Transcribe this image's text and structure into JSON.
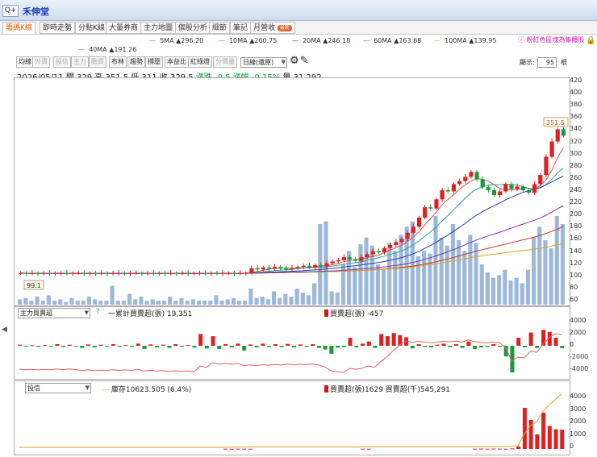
{
  "header": {
    "zoom_label": "Q+",
    "stock_name": "禾伸堂"
  },
  "tabs": [
    {
      "label": "籌碼K線",
      "active": true
    },
    {
      "label": "即時走勢",
      "active": false
    },
    {
      "label": "分點K線",
      "active": false
    },
    {
      "label": "大量券商",
      "active": false
    },
    {
      "label": "主力地圖",
      "active": false
    },
    {
      "label": "個股分析",
      "active": false
    },
    {
      "label": "細節",
      "active": false
    },
    {
      "label": "筆記",
      "active": false
    },
    {
      "label": "月營收",
      "active": false
    }
  ],
  "tab_badge": "最新",
  "hint_text": "ⓘ 粉紅色區塊為集體股",
  "ma_legend": [
    {
      "label": "5MA ▲296.20",
      "color": "#d9534f"
    },
    {
      "label": "10MA ▲260.75",
      "color": "#2aa198"
    },
    {
      "label": "20MA ▲246.18",
      "color": "#1f3fa8"
    },
    {
      "label": "60MA ▲163.68",
      "color": "#c0392b"
    },
    {
      "label": "100MA ▲139.95",
      "color": "#e0a020"
    },
    {
      "label": "40MA ▲191.26",
      "color": "#7a3aa0"
    }
  ],
  "toolbar": {
    "buttons": [
      {
        "label": "均線",
        "dim": false
      },
      {
        "label": "外資",
        "dim": true
      },
      {
        "label": "投信",
        "dim": true
      },
      {
        "label": "主力",
        "dim": true
      },
      {
        "label": "融資",
        "dim": true
      },
      {
        "label": "布林",
        "dim": false
      },
      {
        "label": "趨勢",
        "dim": false
      },
      {
        "label": "撐壓",
        "dim": false
      },
      {
        "label": "本益比",
        "dim": false
      },
      {
        "label": "紅綠燈",
        "dim": false
      },
      {
        "label": "分價量",
        "dim": true
      }
    ],
    "period_select": "日線(還原)",
    "display_label": "顯示:",
    "display_count": "95",
    "display_unit": "根"
  },
  "quote": {
    "date": "2026/05/11",
    "open_label": "開",
    "open": "329",
    "high_label": "高",
    "high": "351.5",
    "low_label": "低",
    "low": "311",
    "close_label": "收",
    "close": "329.5",
    "chg_label": "漲跌",
    "chg": "-0.5",
    "pct_label": "漲幅",
    "pct": "-0.15%",
    "vol_label": "量",
    "vol": "31,292"
  },
  "price_axis": [
    "420",
    "400",
    "380",
    "360",
    "340",
    "320",
    "300",
    "280",
    "260",
    "240",
    "220",
    "200",
    "180",
    "160",
    "140",
    "120",
    "100",
    "80",
    "60"
  ],
  "last_price_tag": "351.5",
  "low_price_tag": "99.1",
  "panel2": {
    "select": "主力買賣超",
    "help": "?",
    "legend_line": "一累計買賣超(張) 19,351",
    "legend_bar": "買賣超(張) -457",
    "axis": [
      "4000",
      "2000",
      "0",
      "-2000",
      "-4000"
    ]
  },
  "panel3": {
    "select": "投信",
    "legend_line": "庫存10623.505 (6.4%)",
    "legend_bar": "買賣超(張)1629 買賣超(千)545,291",
    "axis": [
      "4000",
      "3000",
      "2000",
      "1000",
      "0"
    ]
  },
  "colors": {
    "up": "#e02020",
    "down": "#1a9a3a",
    "volume": "#9db8d8"
  },
  "chart_data": {
    "type": "candlestick",
    "closes": [
      104,
      103,
      104,
      103,
      104,
      103,
      104,
      104,
      103,
      104,
      104,
      103,
      104,
      103,
      104,
      103,
      104,
      104,
      103,
      104,
      104,
      103,
      104,
      103,
      104,
      103,
      104,
      103,
      104,
      103,
      104,
      104,
      103,
      104,
      103,
      104,
      104,
      103,
      104,
      104,
      112,
      110,
      113,
      111,
      114,
      112,
      110,
      112,
      114,
      116,
      113,
      117,
      115,
      120,
      123,
      125,
      130,
      127,
      124,
      130,
      135,
      140,
      138,
      145,
      150,
      155,
      160,
      170,
      180,
      195,
      212,
      210,
      225,
      240,
      238,
      250,
      255,
      262,
      270,
      258,
      245,
      240,
      232,
      238,
      250,
      242,
      246,
      240,
      236,
      250,
      265,
      295,
      320,
      340,
      329.5
    ],
    "volume_panel_axis": "0–220"
  }
}
